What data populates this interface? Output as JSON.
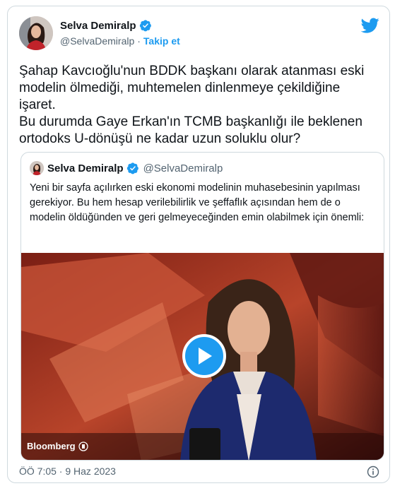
{
  "author": {
    "name": "Selva Demiralp",
    "handle": "@SelvaDemiralp",
    "separator": "·",
    "follow_label": "Takip et"
  },
  "icons": {
    "verified": "verified-badge-icon",
    "brand": "twitter-bird-icon",
    "play": "play-icon",
    "info": "info-icon"
  },
  "colors": {
    "accent": "#1d9bf0",
    "text": "#0f1419",
    "muted": "#536471",
    "border": "#cfd9de"
  },
  "tweet": {
    "text": "Şahap Kavcıoğlu'nun BDDK başkanı olarak atanması  eski modelin ölmediği, muhtemelen dinlenmeye çekildiğine işaret.\nBu durumda Gaye Erkan'ın TCMB başkanlığı ile beklenen ortodoks U-dönüşü ne kadar uzun soluklu olur?"
  },
  "quoted": {
    "name": "Selva Demiralp",
    "handle": "@SelvaDemiralp",
    "text": "Yeni bir sayfa açılırken eski ekonomi modelinin muhasebesinin yapılması gerekiyor. Bu hem hesap verilebilirlik ve şeffaflık açısından hem de o modelin öldüğünden ve geri gelmeyeceğinden emin olabilmek için önemli:",
    "video_watermark": "Bloomberg"
  },
  "footer": {
    "timestamp": "ÖÖ 7:05 · 9 Haz 2023"
  }
}
